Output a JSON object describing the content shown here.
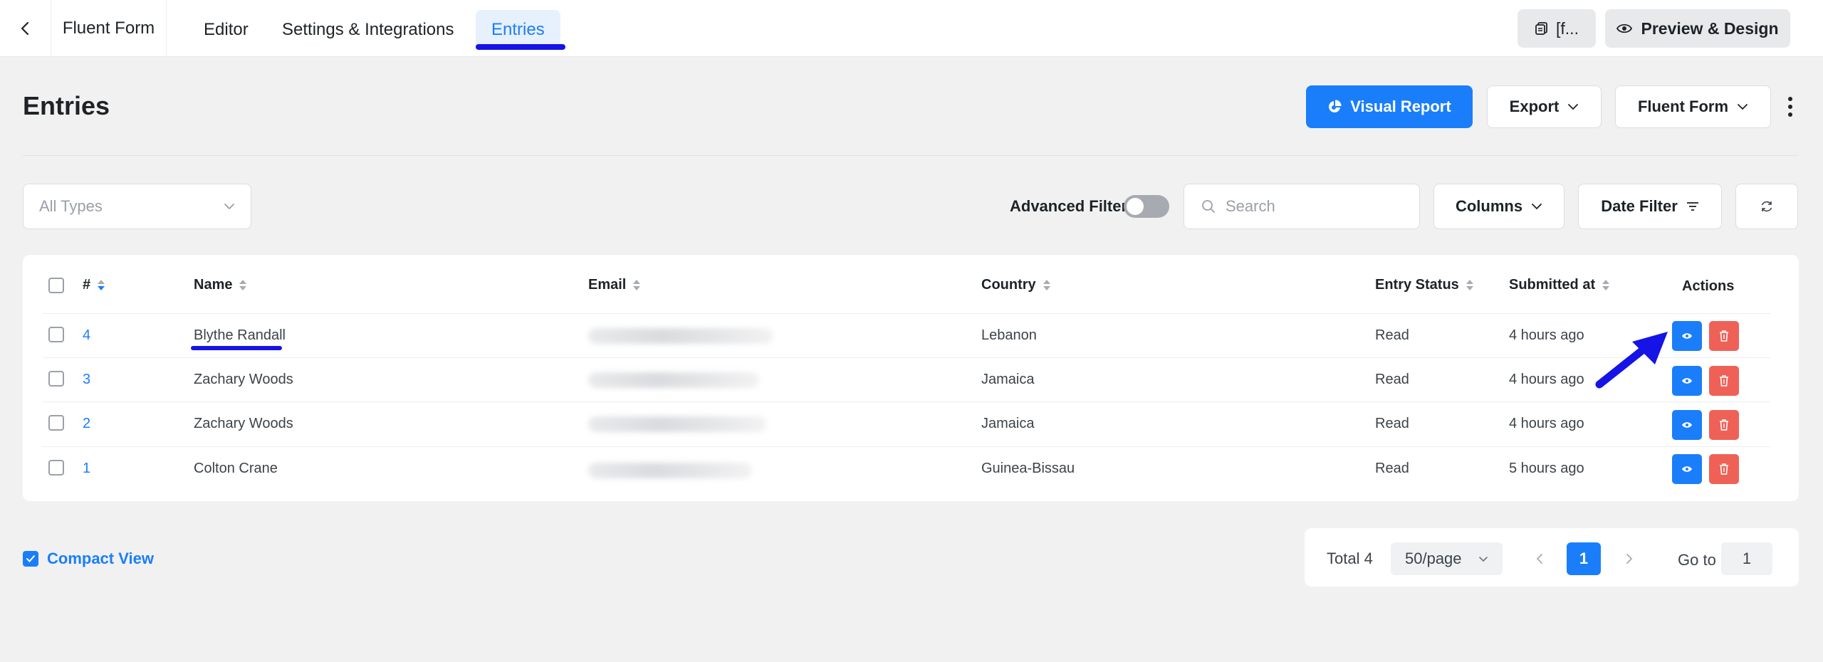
{
  "topbar": {
    "form_name": "Fluent Form",
    "tabs": [
      {
        "label": "Editor"
      },
      {
        "label": "Settings & Integrations"
      },
      {
        "label": "Entries"
      }
    ],
    "shortcode_label": "[f...",
    "preview_label": "Preview & Design"
  },
  "header": {
    "title": "Entries",
    "visual_report_label": "Visual Report",
    "export_label": "Export",
    "form_select_label": "Fluent Form"
  },
  "filters": {
    "types_placeholder": "All Types",
    "advanced_filter_label": "Advanced Filter",
    "search_placeholder": "Search",
    "columns_label": "Columns",
    "date_filter_label": "Date Filter"
  },
  "table": {
    "columns": [
      "#",
      "Name",
      "Email",
      "Country",
      "Entry Status",
      "Submitted at",
      "Actions"
    ],
    "rows": [
      {
        "id": "4",
        "name": "Blythe Randall",
        "country": "Lebanon",
        "status": "Read",
        "submitted": "4 hours ago"
      },
      {
        "id": "3",
        "name": "Zachary Woods",
        "country": "Jamaica",
        "status": "Read",
        "submitted": "4 hours ago"
      },
      {
        "id": "2",
        "name": "Zachary Woods",
        "country": "Jamaica",
        "status": "Read",
        "submitted": "4 hours ago"
      },
      {
        "id": "1",
        "name": "Colton Crane",
        "country": "Guinea-Bissau",
        "status": "Read",
        "submitted": "5 hours ago"
      }
    ]
  },
  "footer": {
    "compact_view_label": "Compact View",
    "total_label": "Total 4",
    "per_page_label": "50/page",
    "current_page": "1",
    "goto_label": "Go to",
    "goto_value": "1"
  },
  "colors": {
    "accent": "#1a7efb",
    "danger": "#ef6157",
    "annotation": "#1513e6"
  }
}
